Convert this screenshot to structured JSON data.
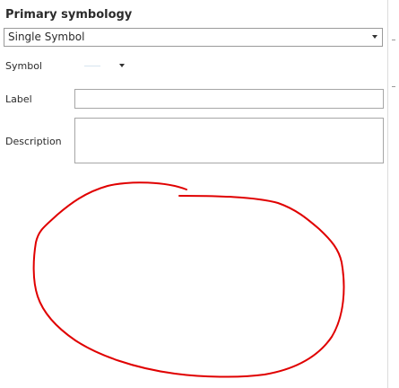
{
  "section": {
    "title": "Primary symbology"
  },
  "symbology_select": {
    "value": "Single Symbol"
  },
  "fields": {
    "symbol_label": "Symbol",
    "label_label": "Label",
    "description_label": "Description",
    "label_value": "",
    "description_value": ""
  },
  "colors": {
    "annotation_stroke": "#e00000",
    "symbol_swatch": "#d6e4ef"
  }
}
